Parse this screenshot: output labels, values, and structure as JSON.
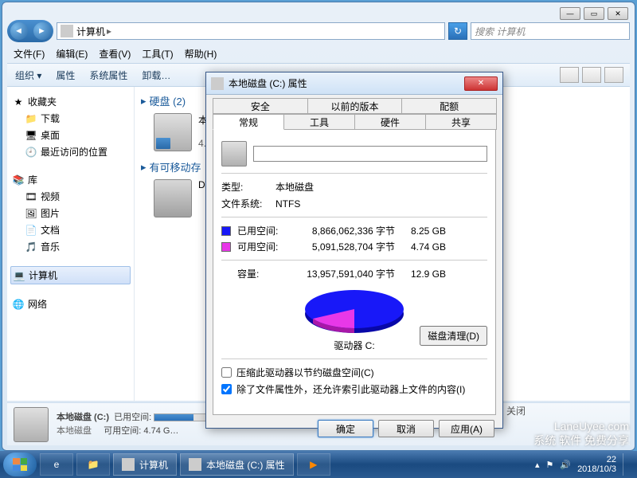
{
  "window": {
    "breadcrumb_root": "计算机",
    "breadcrumb_sep": "▸",
    "search_placeholder": "搜索 计算机"
  },
  "menu": {
    "file": "文件(F)",
    "edit": "编辑(E)",
    "view": "查看(V)",
    "tools": "工具(T)",
    "help": "帮助(H)"
  },
  "toolbar": {
    "organize": "组织 ▾",
    "properties": "属性",
    "sysprops": "系统属性",
    "uninstall": "卸载…"
  },
  "sidebar": {
    "favorites": "收藏夹",
    "fav_items": [
      "下载",
      "桌面",
      "最近访问的位置"
    ],
    "libraries": "库",
    "lib_items": [
      "视频",
      "图片",
      "文档",
      "音乐"
    ],
    "computer": "计算机",
    "network": "网络"
  },
  "main": {
    "hdd_header": "硬盘 (2)",
    "hdd_name_prefix": "本",
    "hdd_size_prefix": "4.7",
    "removable_header": "有可移动存",
    "dvd_label": "DV"
  },
  "details": {
    "name": "本地磁盘 (C:)",
    "type": "本地磁盘",
    "used_label": "已用空间:",
    "free_label": "可用空间:",
    "free_value": "4.74 G…",
    "close_tooltip": "关闭"
  },
  "dialog": {
    "title": "本地磁盘 (C:) 属性",
    "tabs_row1": [
      "安全",
      "以前的版本",
      "配额"
    ],
    "tabs_row2": [
      "常规",
      "工具",
      "硬件",
      "共享"
    ],
    "type_label": "类型:",
    "type_value": "本地磁盘",
    "fs_label": "文件系统:",
    "fs_value": "NTFS",
    "used_label": "已用空间:",
    "used_bytes": "8,866,062,336 字节",
    "used_gb": "8.25 GB",
    "free_label": "可用空间:",
    "free_bytes": "5,091,528,704 字节",
    "free_gb": "4.74 GB",
    "capacity_label": "容量:",
    "capacity_bytes": "13,957,591,040 字节",
    "capacity_gb": "12.9 GB",
    "drive_label": "驱动器 C:",
    "cleanup_btn": "磁盘清理(D)",
    "compress_cb": "压缩此驱动器以节约磁盘空间(C)",
    "index_cb": "除了文件属性外，还允许索引此驱动器上文件的内容(I)",
    "ok_btn": "确定",
    "cancel_btn": "取消",
    "apply_btn": "应用(A)"
  },
  "taskbar": {
    "item1": "计算机",
    "item2": "本地磁盘 (C:) 属性",
    "clock_time": "22",
    "clock_date": "2018/10/3"
  },
  "watermark": {
    "line1": "LaneUyee.com",
    "line2": "系统 软件 免费分享"
  },
  "chart_data": {
    "type": "pie",
    "title": "驱动器 C:",
    "series": [
      {
        "name": "已用空间",
        "value": 8866062336,
        "display": "8.25 GB",
        "color": "#1818f8"
      },
      {
        "name": "可用空间",
        "value": 5091528704,
        "display": "4.74 GB",
        "color": "#e838e8"
      }
    ],
    "total": {
      "name": "容量",
      "value": 13957591040,
      "display": "12.9 GB"
    }
  }
}
